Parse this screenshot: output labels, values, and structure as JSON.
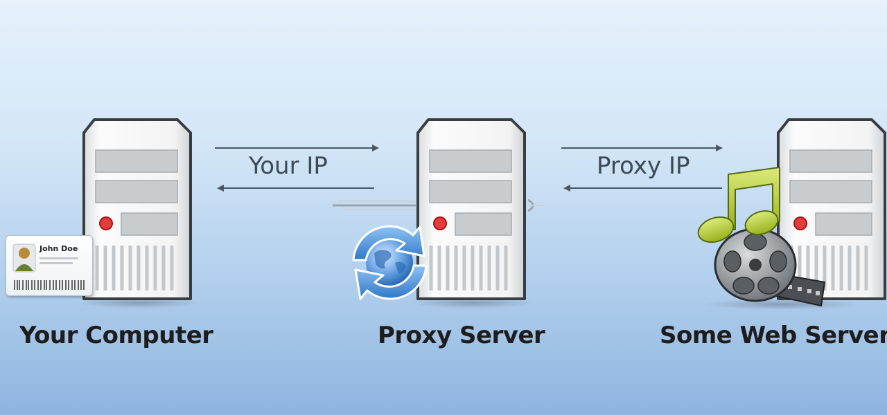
{
  "nodes": [
    {
      "id": "your-computer",
      "label": "Your Computer"
    },
    {
      "id": "proxy-server",
      "label": "Proxy Server"
    },
    {
      "id": "web-server",
      "label": "Some Web Server"
    }
  ],
  "connections": [
    {
      "text": "Your IP"
    },
    {
      "text": "Proxy IP"
    }
  ],
  "id_card": {
    "name": "John Doe"
  },
  "colors": {
    "server_body": "#f4f4f4",
    "server_outline": "#3a3d40",
    "led": "#d11f1f",
    "note": "#b6cf2e",
    "refresh_icon": "#2f78c8"
  }
}
